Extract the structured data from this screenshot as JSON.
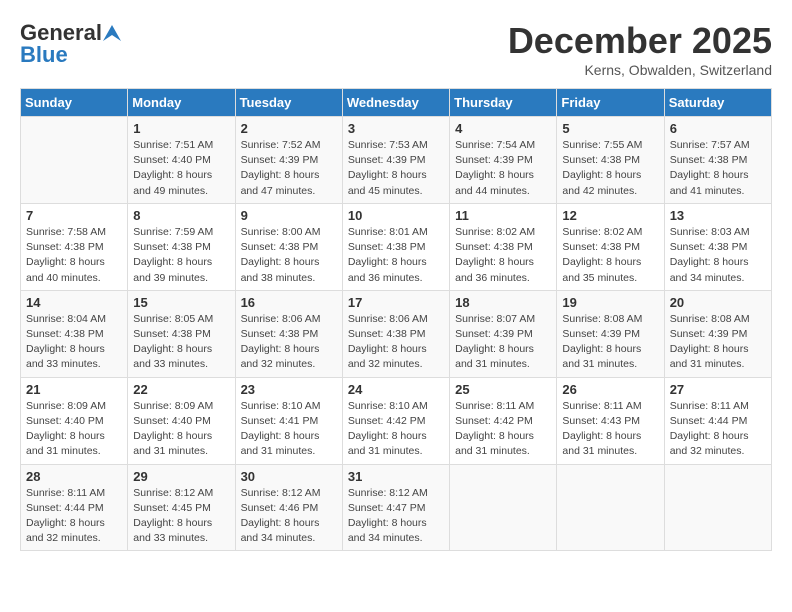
{
  "header": {
    "logo_general": "General",
    "logo_blue": "Blue",
    "month_title": "December 2025",
    "location": "Kerns, Obwalden, Switzerland"
  },
  "weekdays": [
    "Sunday",
    "Monday",
    "Tuesday",
    "Wednesday",
    "Thursday",
    "Friday",
    "Saturday"
  ],
  "weeks": [
    [
      {
        "num": "",
        "info": ""
      },
      {
        "num": "1",
        "info": "Sunrise: 7:51 AM\nSunset: 4:40 PM\nDaylight: 8 hours\nand 49 minutes."
      },
      {
        "num": "2",
        "info": "Sunrise: 7:52 AM\nSunset: 4:39 PM\nDaylight: 8 hours\nand 47 minutes."
      },
      {
        "num": "3",
        "info": "Sunrise: 7:53 AM\nSunset: 4:39 PM\nDaylight: 8 hours\nand 45 minutes."
      },
      {
        "num": "4",
        "info": "Sunrise: 7:54 AM\nSunset: 4:39 PM\nDaylight: 8 hours\nand 44 minutes."
      },
      {
        "num": "5",
        "info": "Sunrise: 7:55 AM\nSunset: 4:38 PM\nDaylight: 8 hours\nand 42 minutes."
      },
      {
        "num": "6",
        "info": "Sunrise: 7:57 AM\nSunset: 4:38 PM\nDaylight: 8 hours\nand 41 minutes."
      }
    ],
    [
      {
        "num": "7",
        "info": "Sunrise: 7:58 AM\nSunset: 4:38 PM\nDaylight: 8 hours\nand 40 minutes."
      },
      {
        "num": "8",
        "info": "Sunrise: 7:59 AM\nSunset: 4:38 PM\nDaylight: 8 hours\nand 39 minutes."
      },
      {
        "num": "9",
        "info": "Sunrise: 8:00 AM\nSunset: 4:38 PM\nDaylight: 8 hours\nand 38 minutes."
      },
      {
        "num": "10",
        "info": "Sunrise: 8:01 AM\nSunset: 4:38 PM\nDaylight: 8 hours\nand 36 minutes."
      },
      {
        "num": "11",
        "info": "Sunrise: 8:02 AM\nSunset: 4:38 PM\nDaylight: 8 hours\nand 36 minutes."
      },
      {
        "num": "12",
        "info": "Sunrise: 8:02 AM\nSunset: 4:38 PM\nDaylight: 8 hours\nand 35 minutes."
      },
      {
        "num": "13",
        "info": "Sunrise: 8:03 AM\nSunset: 4:38 PM\nDaylight: 8 hours\nand 34 minutes."
      }
    ],
    [
      {
        "num": "14",
        "info": "Sunrise: 8:04 AM\nSunset: 4:38 PM\nDaylight: 8 hours\nand 33 minutes."
      },
      {
        "num": "15",
        "info": "Sunrise: 8:05 AM\nSunset: 4:38 PM\nDaylight: 8 hours\nand 33 minutes."
      },
      {
        "num": "16",
        "info": "Sunrise: 8:06 AM\nSunset: 4:38 PM\nDaylight: 8 hours\nand 32 minutes."
      },
      {
        "num": "17",
        "info": "Sunrise: 8:06 AM\nSunset: 4:38 PM\nDaylight: 8 hours\nand 32 minutes."
      },
      {
        "num": "18",
        "info": "Sunrise: 8:07 AM\nSunset: 4:39 PM\nDaylight: 8 hours\nand 31 minutes."
      },
      {
        "num": "19",
        "info": "Sunrise: 8:08 AM\nSunset: 4:39 PM\nDaylight: 8 hours\nand 31 minutes."
      },
      {
        "num": "20",
        "info": "Sunrise: 8:08 AM\nSunset: 4:39 PM\nDaylight: 8 hours\nand 31 minutes."
      }
    ],
    [
      {
        "num": "21",
        "info": "Sunrise: 8:09 AM\nSunset: 4:40 PM\nDaylight: 8 hours\nand 31 minutes."
      },
      {
        "num": "22",
        "info": "Sunrise: 8:09 AM\nSunset: 4:40 PM\nDaylight: 8 hours\nand 31 minutes."
      },
      {
        "num": "23",
        "info": "Sunrise: 8:10 AM\nSunset: 4:41 PM\nDaylight: 8 hours\nand 31 minutes."
      },
      {
        "num": "24",
        "info": "Sunrise: 8:10 AM\nSunset: 4:42 PM\nDaylight: 8 hours\nand 31 minutes."
      },
      {
        "num": "25",
        "info": "Sunrise: 8:11 AM\nSunset: 4:42 PM\nDaylight: 8 hours\nand 31 minutes."
      },
      {
        "num": "26",
        "info": "Sunrise: 8:11 AM\nSunset: 4:43 PM\nDaylight: 8 hours\nand 31 minutes."
      },
      {
        "num": "27",
        "info": "Sunrise: 8:11 AM\nSunset: 4:44 PM\nDaylight: 8 hours\nand 32 minutes."
      }
    ],
    [
      {
        "num": "28",
        "info": "Sunrise: 8:11 AM\nSunset: 4:44 PM\nDaylight: 8 hours\nand 32 minutes."
      },
      {
        "num": "29",
        "info": "Sunrise: 8:12 AM\nSunset: 4:45 PM\nDaylight: 8 hours\nand 33 minutes."
      },
      {
        "num": "30",
        "info": "Sunrise: 8:12 AM\nSunset: 4:46 PM\nDaylight: 8 hours\nand 34 minutes."
      },
      {
        "num": "31",
        "info": "Sunrise: 8:12 AM\nSunset: 4:47 PM\nDaylight: 8 hours\nand 34 minutes."
      },
      {
        "num": "",
        "info": ""
      },
      {
        "num": "",
        "info": ""
      },
      {
        "num": "",
        "info": ""
      }
    ]
  ]
}
